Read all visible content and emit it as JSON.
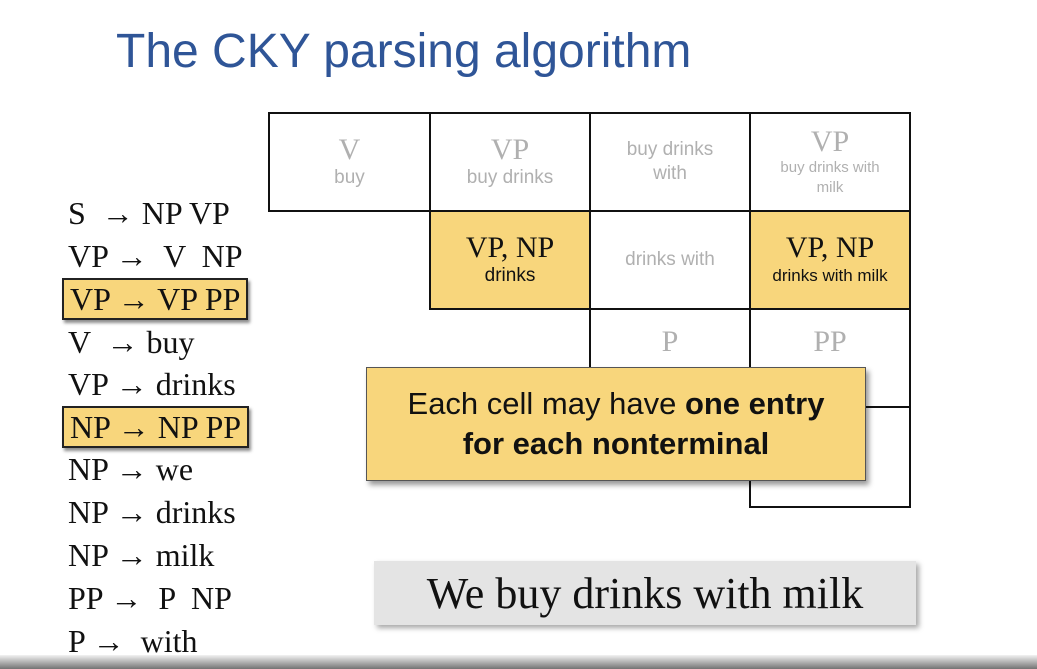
{
  "title": "The CKY parsing algorithm",
  "grammar": [
    {
      "text": "S  → NP VP",
      "highlight": false
    },
    {
      "text": "VP →  V  NP",
      "highlight": false
    },
    {
      "text": "VP → VP PP",
      "highlight": true
    },
    {
      "text": "V  → buy",
      "highlight": false
    },
    {
      "text": "VP → drinks",
      "highlight": false
    },
    {
      "text": "NP → NP PP",
      "highlight": true
    },
    {
      "text": "NP → we",
      "highlight": false
    },
    {
      "text": "NP → drinks",
      "highlight": false
    },
    {
      "text": "NP → milk",
      "highlight": false
    },
    {
      "text": "PP →  P  NP",
      "highlight": false
    },
    {
      "text": "P →  with",
      "highlight": false
    }
  ],
  "chart": {
    "r0c0": {
      "nt": "V",
      "span": "buy"
    },
    "r0c1": {
      "nt": "VP",
      "span": "buy drinks"
    },
    "r0c2": {
      "nt": "",
      "span": "buy drinks with"
    },
    "r0c3": {
      "nt": "VP",
      "span": "buy drinks with milk"
    },
    "r1c1": {
      "nt": "VP, NP",
      "span": "drinks"
    },
    "r1c2": {
      "nt": "",
      "span": "drinks with"
    },
    "r1c3": {
      "nt": "VP, NP",
      "span": "drinks with milk"
    },
    "r2c2": {
      "nt": "P",
      "span": ""
    },
    "r2c3": {
      "nt": "PP",
      "span": ""
    }
  },
  "callout": {
    "line1_plain": "Each cell may have ",
    "line1_bold": "one entry",
    "line2_bold": "for each nonterminal"
  },
  "sentence": "We buy drinks with milk",
  "colors": {
    "title": "#2f5597",
    "highlight": "#f8d67c",
    "faded_text": "#b0b0b0"
  }
}
